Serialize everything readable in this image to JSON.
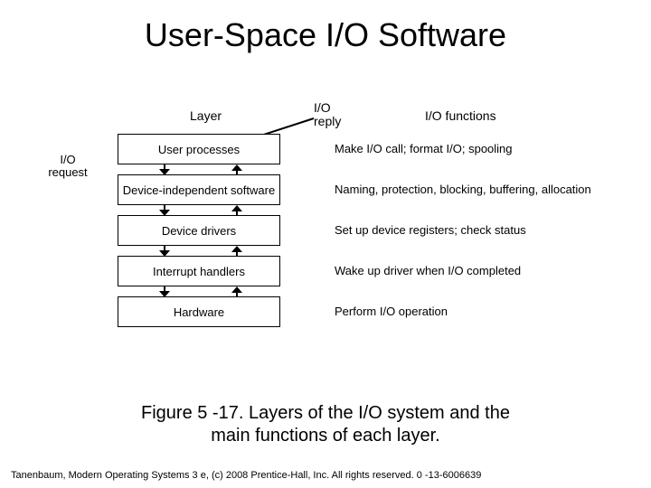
{
  "title": "User-Space I/O Software",
  "caption_line1": "Figure 5 -17. Layers of the I/O system and the",
  "caption_line2": "main functions of each layer.",
  "copyright": "Tanenbaum, Modern Operating Systems 3 e, (c) 2008 Prentice-Hall, Inc. All rights reserved. 0 -13-6006639",
  "headers": {
    "layer": "Layer",
    "reply": "I/O reply",
    "functions": "I/O functions"
  },
  "io_request": "I/O request",
  "layers": [
    {
      "name": "User processes",
      "function": "Make I/O call; format I/O; spooling"
    },
    {
      "name": "Device-independent software",
      "function": "Naming, protection, blocking, buffering, allocation"
    },
    {
      "name": "Device drivers",
      "function": "Set up device registers; check status"
    },
    {
      "name": "Interrupt handlers",
      "function": "Wake up driver when I/O completed"
    },
    {
      "name": "Hardware",
      "function": "Perform I/O operation"
    }
  ]
}
